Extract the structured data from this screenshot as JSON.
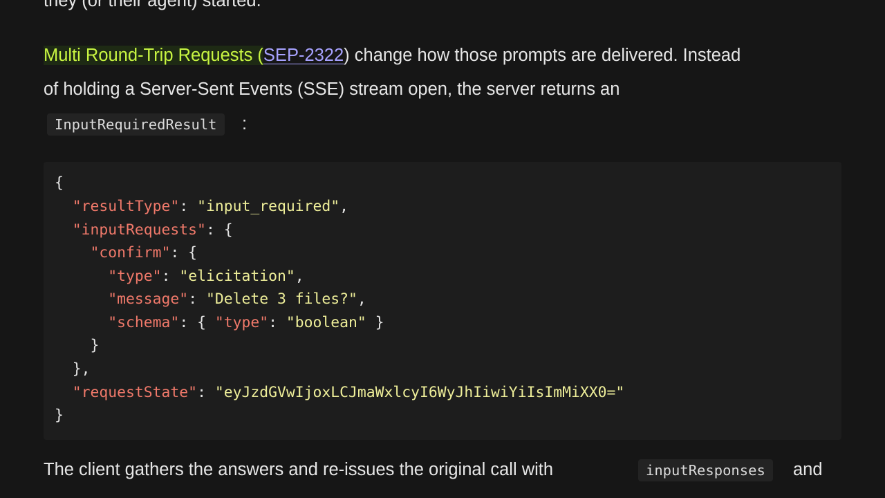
{
  "article": {
    "top_partial": "they (or their agent) started.",
    "para1": {
      "highlight": "Multi Round-Trip Requests (",
      "link": "SEP-2322",
      "close_paren": ")",
      "rest_line1": " change how those prompts are delivered. Instead",
      "line2": "of holding a Server-Sent Events (SSE) stream open, the server returns an",
      "code": "InputRequiredResult",
      "after_code": ":"
    },
    "code_block": {
      "lines": [
        "{",
        "  \"resultType\": \"input_required\",",
        "  \"inputRequests\": {",
        "    \"confirm\": {",
        "      \"type\": \"elicitation\",",
        "      \"message\": \"Delete 3 files?\",",
        "      \"schema\": { \"type\": \"boolean\" }",
        "    }",
        "  },",
        "  \"requestState\": \"eyJzdGVwIjoxLCJmaWxlcyI6WyJhIiwiYiIsImMiXX0=\"",
        "}"
      ]
    },
    "para2": {
      "text_before": "The client gathers the answers and re-issues the original call with",
      "code": "inputResponses",
      "text_after": "and"
    }
  },
  "colors": {
    "background": "#161616",
    "highlight_text": "#c8f542",
    "link": "#a7a2ff",
    "json_key": "#f0796a",
    "json_string": "#eeee99"
  }
}
